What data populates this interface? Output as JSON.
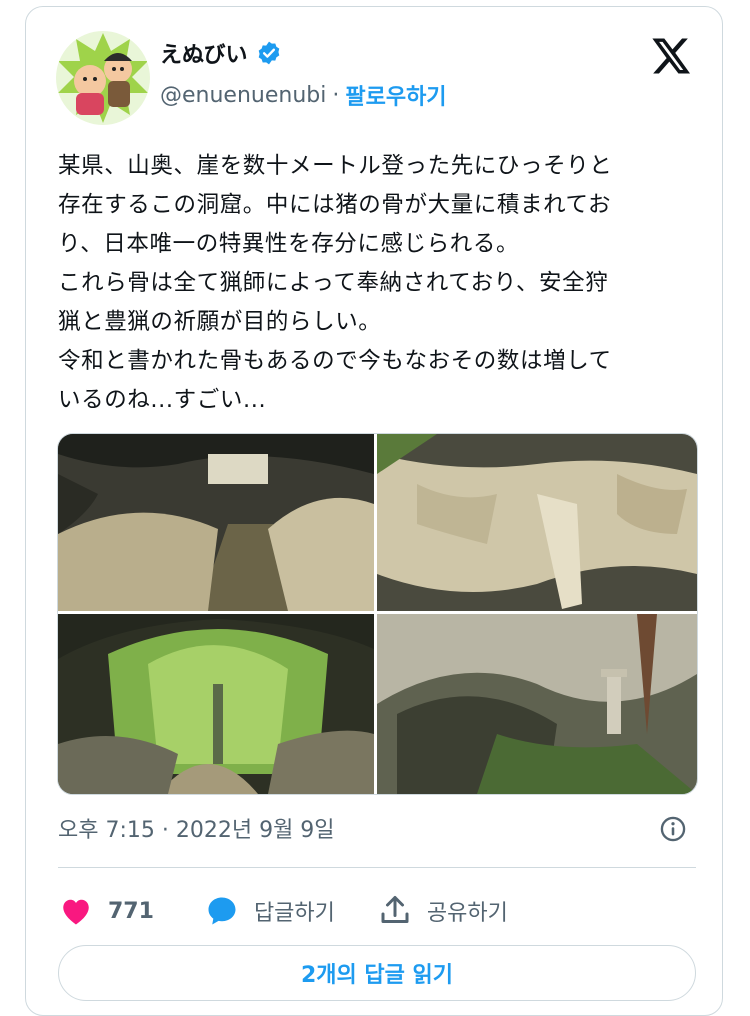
{
  "author": {
    "display_name": "えぬびい",
    "handle": "@enuenuenubi",
    "separator": "·",
    "follow_label": "팔로우하기",
    "verified": true
  },
  "platform_icon": "x-logo-icon",
  "tweet": {
    "text": "某県、山奥、崖を数十メートル登った先にひっそりと\n存在するこの洞窟。中には猪の骨が大量に積まれてお\nり、日本唯一の特異性を存分に感じられる。\nこれら骨は全て猟師によって奉納されており、安全狩\n猟と豊猟の祈願が目的らしい。\n令和と書かれた骨もあるので今もなおその数は増して\nいるのね...すごい...",
    "images": [
      {
        "name": "cave-entrance-with-bones",
        "tone": "dark"
      },
      {
        "name": "boar-skull-closeup",
        "tone": "bone"
      },
      {
        "name": "cave-opening-forest",
        "tone": "green"
      },
      {
        "name": "cave-rock-formations",
        "tone": "grey"
      }
    ]
  },
  "meta": {
    "timestamp": "오후 7:15 · 2022년 9월 9일"
  },
  "actions": {
    "like_count": "771",
    "reply_label": "답글하기",
    "share_label": "공유하기"
  },
  "read_replies_label": "2개의 답글 읽기",
  "colors": {
    "accent": "#1d9bf0",
    "like": "#f91880",
    "text": "#0f1419",
    "muted": "#536471",
    "border": "#cfd9de"
  }
}
